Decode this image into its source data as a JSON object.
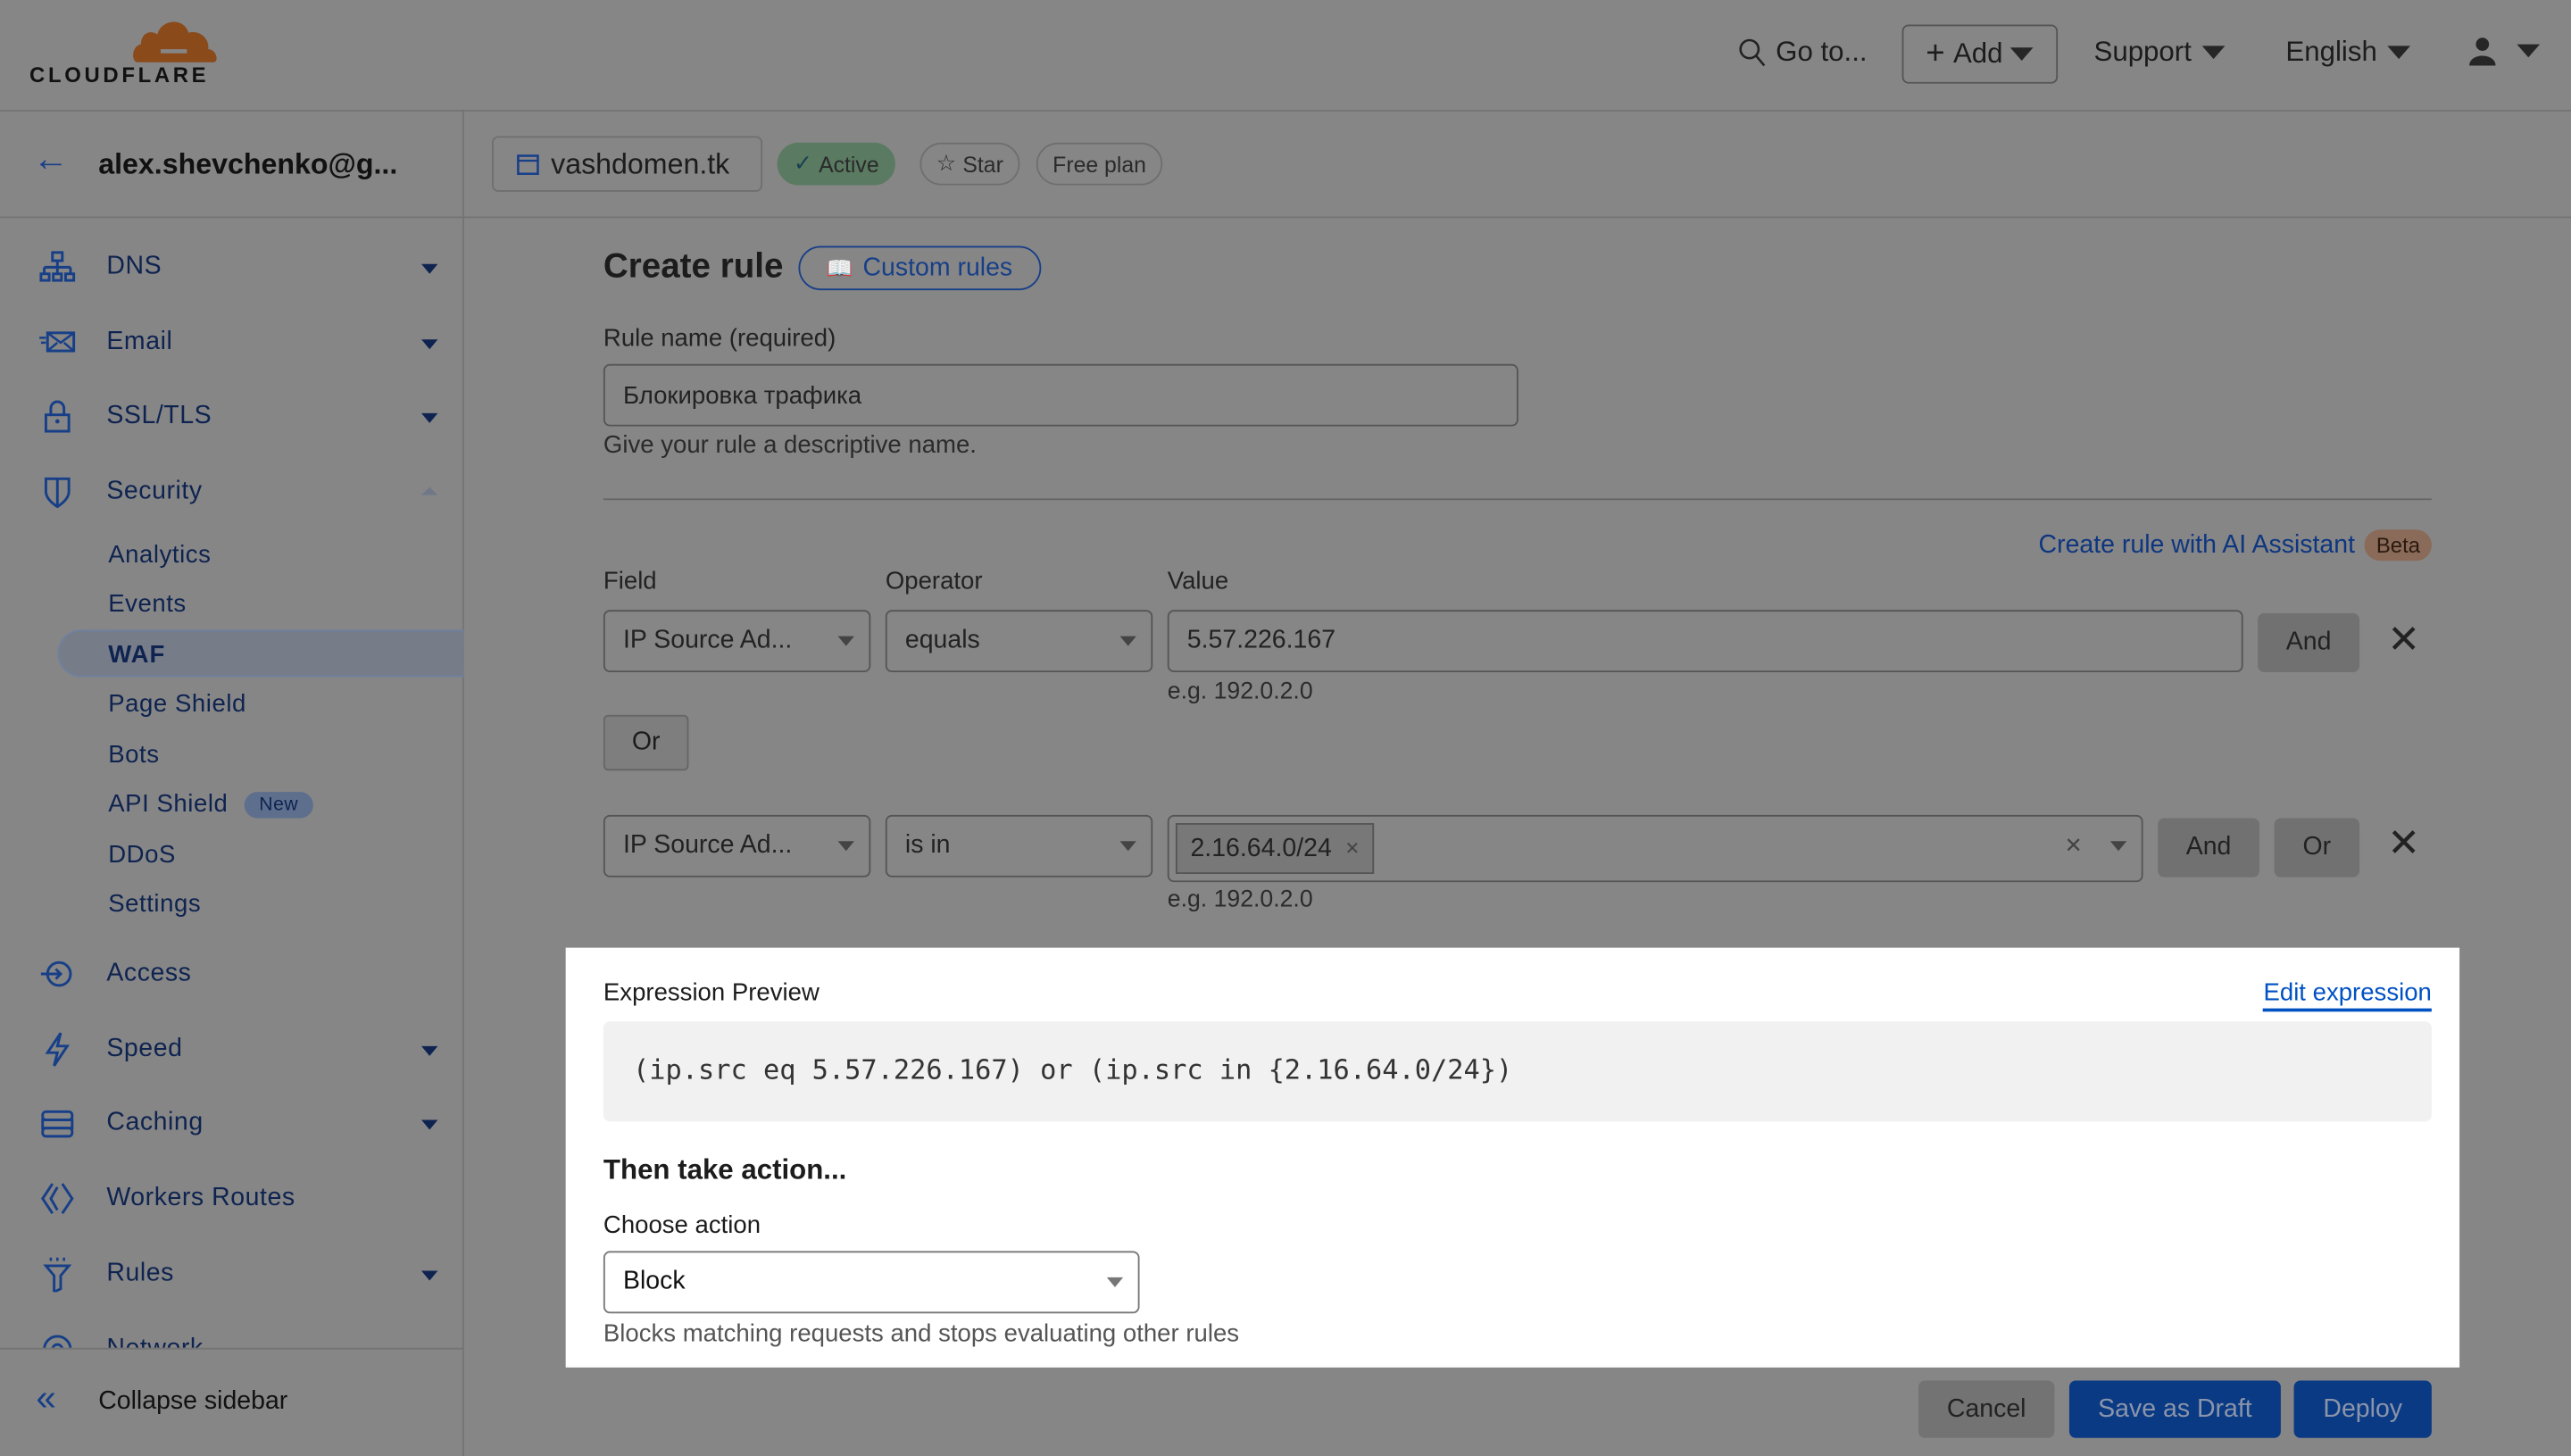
{
  "header": {
    "logo_text": "CLOUDFLARE",
    "goto_label": "Go to...",
    "add_label": "Add",
    "support_label": "Support",
    "language_label": "English"
  },
  "sidebar": {
    "account": "alex.shevchenko@g...",
    "items": [
      {
        "label": "DNS",
        "icon": "sitemap-icon"
      },
      {
        "label": "Email",
        "icon": "envelope-icon"
      },
      {
        "label": "SSL/TLS",
        "icon": "lock-icon"
      },
      {
        "label": "Security",
        "icon": "shield-icon"
      },
      {
        "label": "Access",
        "icon": "access-icon"
      },
      {
        "label": "Speed",
        "icon": "lightning-icon"
      },
      {
        "label": "Caching",
        "icon": "server-stack-icon"
      },
      {
        "label": "Workers Routes",
        "icon": "workers-icon"
      },
      {
        "label": "Rules",
        "icon": "rules-icon"
      },
      {
        "label": "Network",
        "icon": "network-icon"
      }
    ],
    "security_sub": [
      "Analytics",
      "Events",
      "WAF",
      "Page Shield",
      "Bots",
      "API Shield",
      "DDoS",
      "Settings"
    ],
    "new_badge": "New",
    "collapse_label": "Collapse sidebar"
  },
  "domain_bar": {
    "domain": "vashdomen.tk",
    "status": "Active",
    "star": "Star",
    "plan": "Free plan"
  },
  "form": {
    "title": "Create rule",
    "custom_rules_link": "Custom rules",
    "rule_name_label": "Rule name (required)",
    "rule_name_value": "Блокировка трафика",
    "rule_name_help": "Give your rule a descriptive name.",
    "ai_link": "Create rule with AI Assistant",
    "beta_badge": "Beta",
    "field_label": "Field",
    "operator_label": "Operator",
    "value_label": "Value",
    "rows": [
      {
        "field": "IP Source Ad...",
        "operator": "equals",
        "value": "5.57.226.167",
        "hint": "e.g. 192.0.2.0"
      },
      {
        "field": "IP Source Ad...",
        "operator": "is in",
        "value": "2.16.64.0/24",
        "hint": "e.g. 192.0.2.0"
      }
    ],
    "and_label": "And",
    "or_label": "Or",
    "expression_label": "Expression Preview",
    "edit_expression": "Edit expression",
    "expression": "(ip.src eq 5.57.226.167) or (ip.src in {2.16.64.0/24})",
    "action_heading": "Then take action...",
    "choose_action_label": "Choose action",
    "action_value": "Block",
    "action_help": "Blocks matching requests and stops evaluating other rules"
  },
  "footer": {
    "cancel": "Cancel",
    "save_draft": "Save as Draft",
    "deploy": "Deploy"
  },
  "colors": {
    "brand_orange": "#8a4a1a",
    "accent_blue": "#0051c3",
    "overlay": "#868686",
    "active_green": "#5a7a62"
  }
}
